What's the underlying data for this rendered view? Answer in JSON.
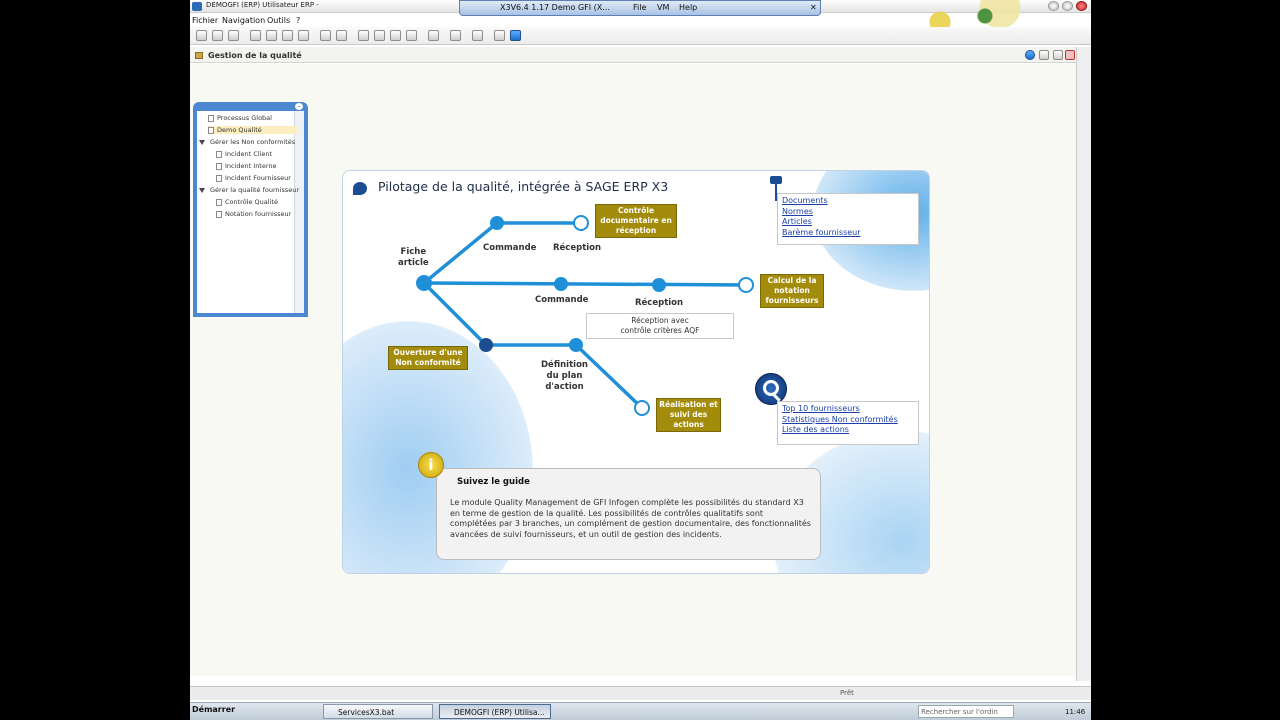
{
  "window": {
    "title": "DEMOGFI (ERP) Utilisateur ERP -",
    "remote_title": "X3V6.4 1.17 Demo GFI (X...",
    "remote_menu": [
      "File",
      "VM",
      "Help"
    ]
  },
  "menubar": [
    "Fichier",
    "Navigation",
    "Outils",
    "?"
  ],
  "breadcrumb": "Gestion de la qualité",
  "tree": {
    "items": [
      {
        "label": "Processus Global",
        "type": "doc"
      },
      {
        "label": "Demo Qualité",
        "type": "doc",
        "selected": true
      },
      {
        "label": "Gérer les Non conformités",
        "type": "folder"
      },
      {
        "label": "Incident Client",
        "type": "doc"
      },
      {
        "label": "Incident Interne",
        "type": "doc"
      },
      {
        "label": "Incident Fournisseur",
        "type": "doc"
      },
      {
        "label": "Gérer la qualité fournisseur",
        "type": "folder"
      },
      {
        "label": "Contrôle Qualité",
        "type": "doc"
      },
      {
        "label": "Notation fournisseur",
        "type": "doc"
      }
    ]
  },
  "panel": {
    "title": "Pilotage de la qualité, intégrée à SAGE ERP X3",
    "labels": {
      "fiche_article": "Fiche\narticle",
      "commande1": "Commande",
      "reception1": "Réception",
      "commande2": "Commande",
      "reception2": "Réception",
      "definition": "Définition\ndu plan\nd'action"
    },
    "boxes": {
      "controle_doc": "Contrôle\ndocumentaire en\nréception",
      "calcul_notation": "Calcul de la\nnotation\nfournisseurs",
      "ouverture_nc": "Ouverture d'une\nNon conformité",
      "realisation": "Réalisation et\nsuivi des\nactions",
      "reception_aqf": "Réception avec\ncontrôle critères AQF"
    },
    "links_docs": [
      "Documents",
      "Normes",
      "Articles",
      "Barème fournisseur"
    ],
    "links_stats": [
      "Top 10 fournisseurs",
      "Statistiques Non conformités",
      "Liste des actions"
    ],
    "guide": {
      "heading": "Suivez le guide",
      "text": "Le module Quality Management de GFI Infogen complète les possibilités du standard X3 en terme de gestion de la qualité. Les possibilités de contrôles qualitatifs sont complétées par 3 branches, un complément de gestion documentaire, des fonctionnalités avancées de suivi fournisseurs, et un outil de gestion des incidents."
    }
  },
  "statusbar": {
    "text": "Prêt"
  },
  "taskbar": {
    "start": "Démarrer",
    "tasks": [
      "ServicesX3.bat",
      "DEMOGFI (ERP) Utilisa..."
    ],
    "search_placeholder": "Rechercher sur l'ordin",
    "clock": "11:46"
  },
  "colors": {
    "accent": "#1b4d92",
    "flow": "#1f8fd8",
    "box": "#a38c0b",
    "link": "#1a3fa8"
  }
}
